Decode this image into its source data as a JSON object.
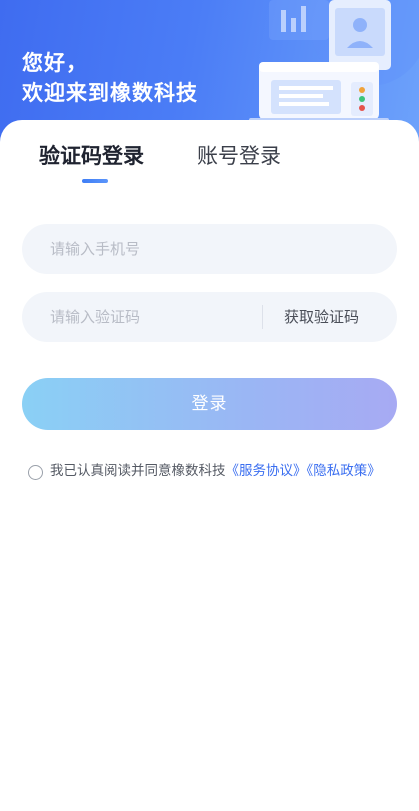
{
  "hero": {
    "greeting_line1": "您好，",
    "greeting_line2": "欢迎来到橡数科技"
  },
  "tabs": [
    {
      "label": "验证码登录",
      "active": true
    },
    {
      "label": "账号登录",
      "active": false
    }
  ],
  "form": {
    "phone_placeholder": "请输入手机号",
    "phone_value": "",
    "code_placeholder": "请输入验证码",
    "code_value": "",
    "get_code_label": "获取验证码",
    "login_label": "登录"
  },
  "agreement": {
    "checked": false,
    "prefix": "我已认真阅读并同意橡数科技",
    "service_link": "《服务协议》",
    "privacy_link": "《隐私政策》"
  },
  "colors": {
    "hero_blue": "#4b7df6",
    "link_blue": "#3a6ef0",
    "indicator": "#3f7ef5",
    "field_bg": "#f2f5fa"
  }
}
